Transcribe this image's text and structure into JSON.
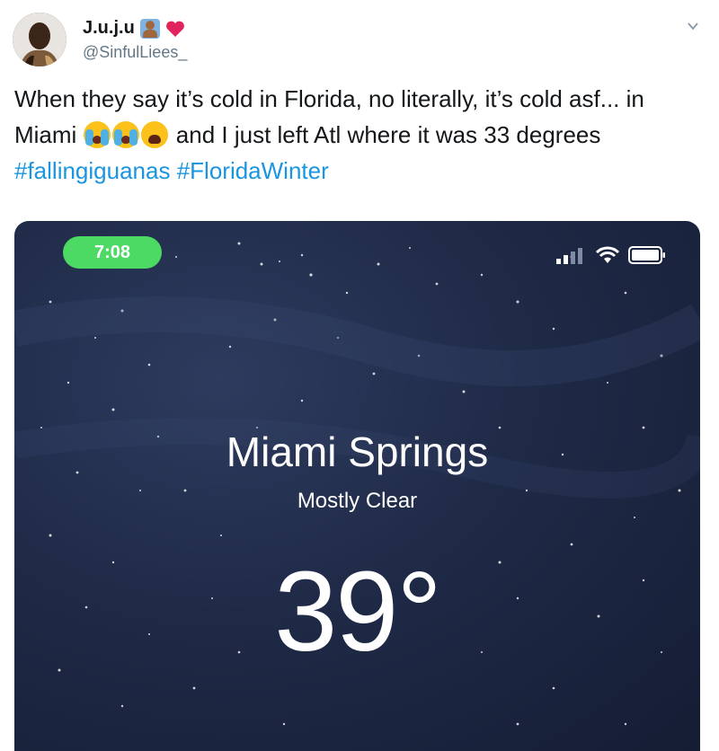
{
  "tweet": {
    "author_name": "J.u.j.u",
    "author_handle": "@SinfulLiees_",
    "text_part1": "When they say it’s cold in Florida, no literally, it’s cold asf... in Miami ",
    "text_part2": " and I just left Atl where it was 33 degrees ",
    "hashtag1": "#fallingiguanas",
    "hashtag2": "#FloridaWinter"
  },
  "weather_screenshot": {
    "time": "7:08",
    "city": "Miami Springs",
    "condition": "Mostly Clear",
    "temperature": "39°"
  },
  "colors": {
    "hashtag": "#1b95e0",
    "status_pill": "#4cd964",
    "sky": "#1f2a47"
  },
  "icons": [
    "person-raising-hand-icon",
    "red-heart-icon",
    "chevron-down-icon",
    "crying-face-icon",
    "weary-face-icon",
    "signal-icon",
    "wifi-icon",
    "battery-icon"
  ]
}
